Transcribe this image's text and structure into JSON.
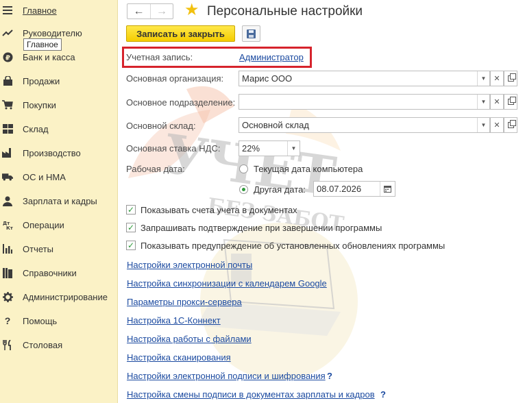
{
  "sidebar": {
    "tooltip": "Главное",
    "items": [
      {
        "label": "Главное",
        "icon": "menu-icon"
      },
      {
        "label": "Руководителю",
        "icon": "trend-icon"
      },
      {
        "label": "Банк и касса",
        "icon": "ruble-icon"
      },
      {
        "label": "Продажи",
        "icon": "bag-icon"
      },
      {
        "label": "Покупки",
        "icon": "cart-icon"
      },
      {
        "label": "Склад",
        "icon": "warehouse-icon"
      },
      {
        "label": "Производство",
        "icon": "factory-icon"
      },
      {
        "label": "ОС и НМА",
        "icon": "truck-icon"
      },
      {
        "label": "Зарплата и кадры",
        "icon": "person-icon"
      },
      {
        "label": "Операции",
        "icon": "dt-kt-icon"
      },
      {
        "label": "Отчеты",
        "icon": "bar-chart-icon"
      },
      {
        "label": "Справочники",
        "icon": "books-icon"
      },
      {
        "label": "Администрирование",
        "icon": "gear-icon"
      },
      {
        "label": "Помощь",
        "icon": "question-icon"
      },
      {
        "label": "Столовая",
        "icon": "cutlery-icon"
      }
    ]
  },
  "header": {
    "title": "Персональные настройки",
    "save_close": "Записать и закрыть"
  },
  "form": {
    "account_label": "Учетная запись:",
    "account_value": "Администратор",
    "org_label": "Основная организация:",
    "org_value": "Марис ООО",
    "dept_label": "Основное подразделение:",
    "dept_value": "",
    "warehouse_label": "Основной склад:",
    "warehouse_value": "Основной склад",
    "vat_label": "Основная ставка НДС:",
    "vat_value": "22%",
    "workdate_label": "Рабочая дата:",
    "radio_current": "Текущая дата компьютера",
    "radio_other": "Другая дата:",
    "other_date": "08.07.2026"
  },
  "checks": [
    {
      "label": "Показывать счета учета в документах",
      "checked": true
    },
    {
      "label": "Запрашивать подтверждение при завершении программы",
      "checked": true
    },
    {
      "label": "Показывать предупреждение об установленных обновлениях программы",
      "checked": true
    }
  ],
  "links": [
    "Настройки электронной почты",
    "Настройка синхронизации с календарем Google",
    "Параметры прокси-сервера",
    "Настройка 1С-Коннект",
    "Настройка работы с файлами",
    "Настройка сканирования",
    "Настройки электронной подписи и шифрования",
    "Настройка смены подписи в документах зарплаты и кадров"
  ],
  "help_mark": "?",
  "watermark": {
    "line1": "УЧЕТ",
    "line2": "БЕЗ ЗАБОТ"
  },
  "colors": {
    "sidebar_bg": "#fbf2c6",
    "accent_yellow": "#f5cd00",
    "link": "#1b4aa0",
    "highlight_red": "#d6232c",
    "check_green": "#2f9a3b"
  }
}
